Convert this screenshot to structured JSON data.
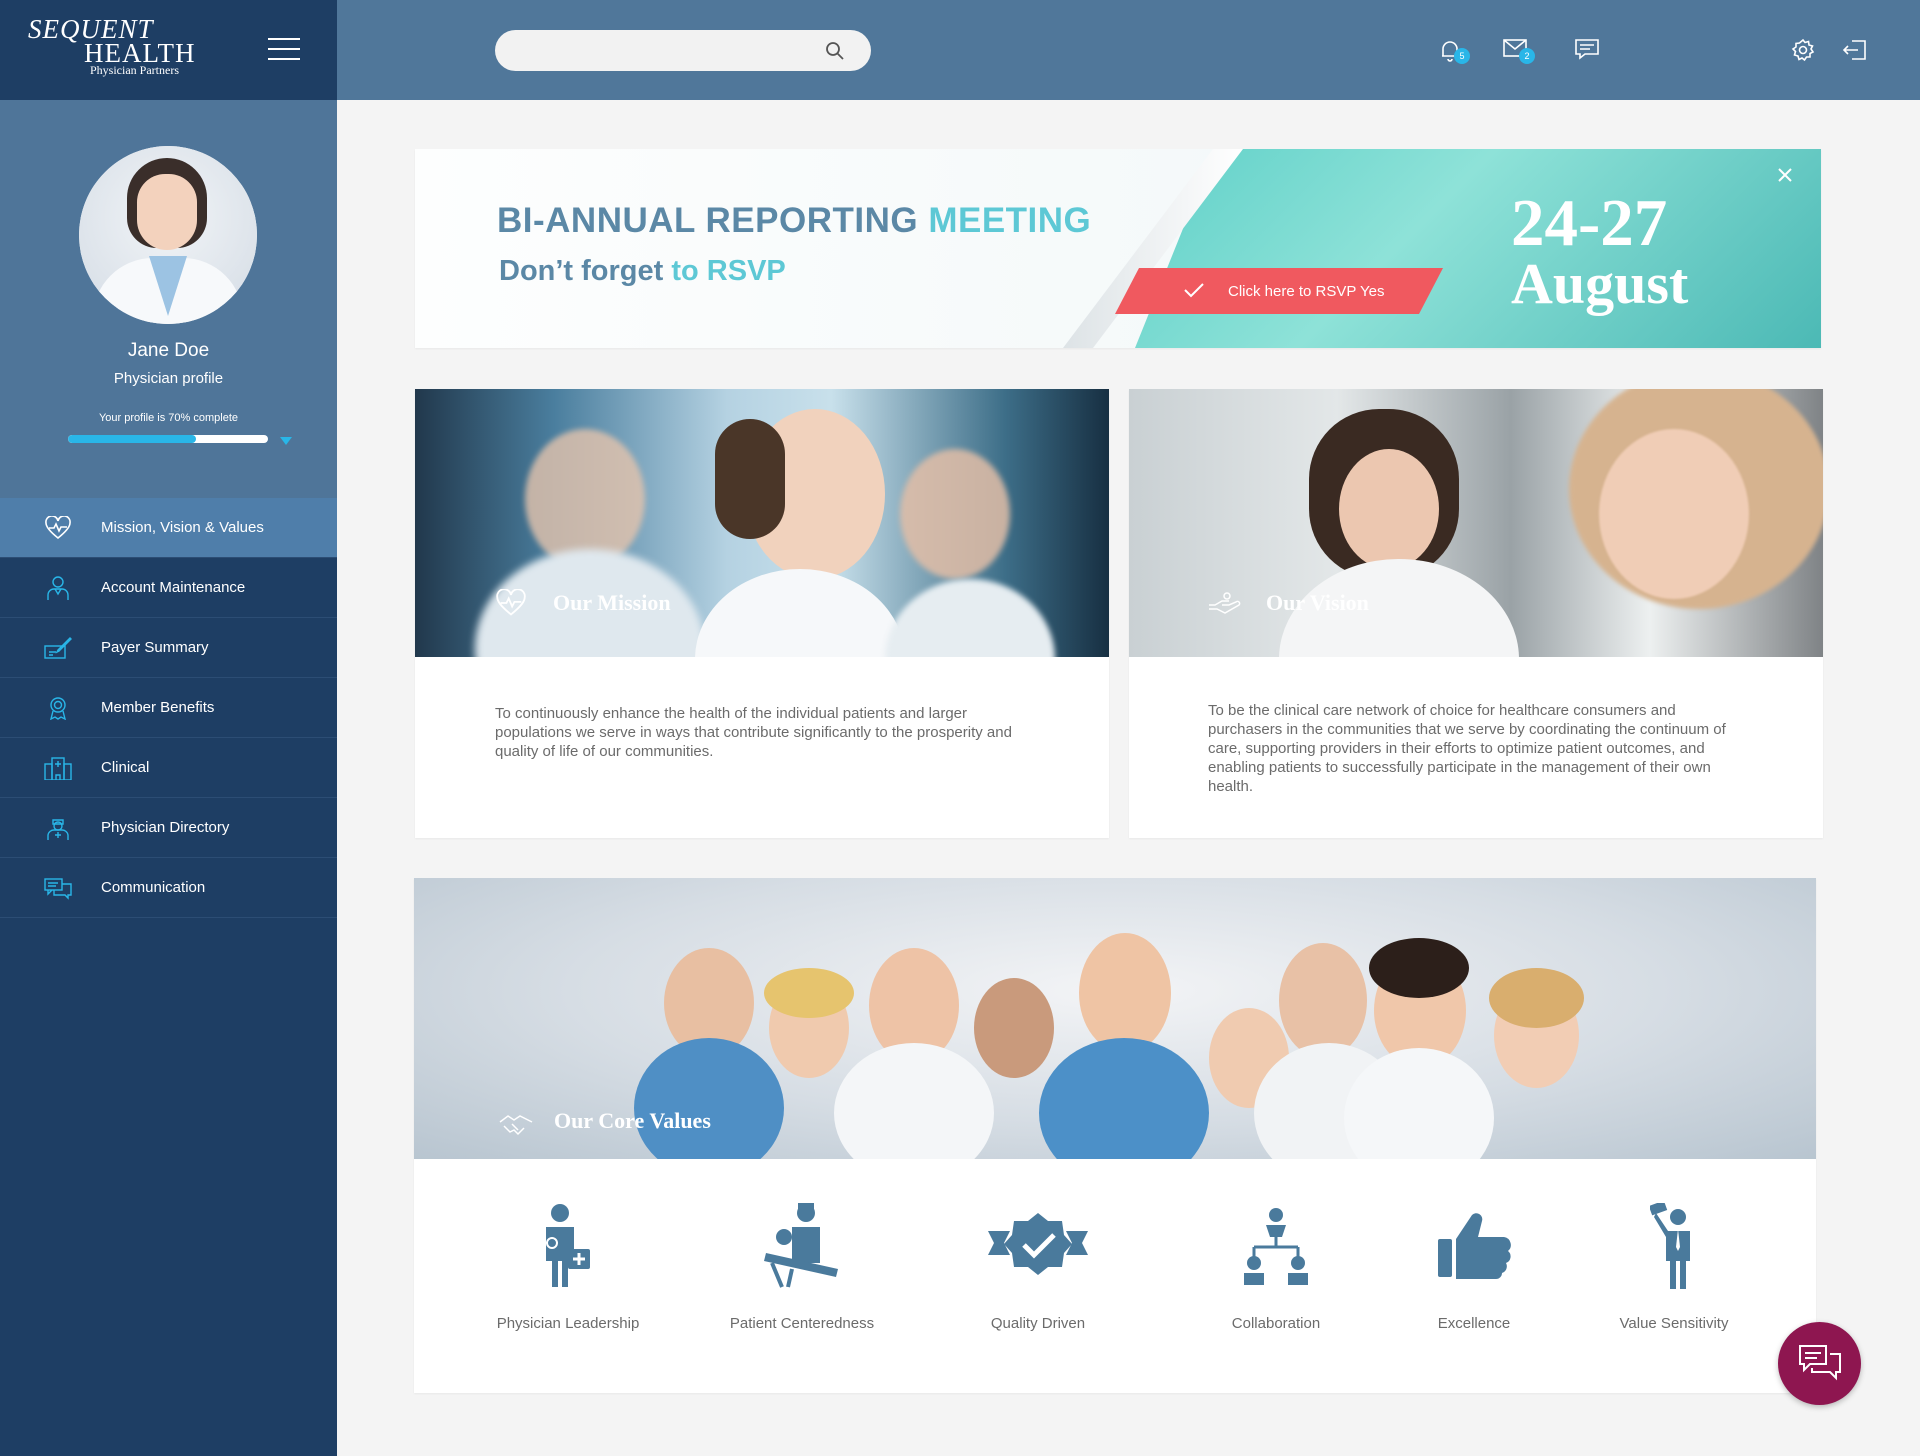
{
  "brand": {
    "line1": "SEQUENT",
    "line2": "HEALTH",
    "line3": "Physician Partners"
  },
  "header": {
    "search": {
      "placeholder": "",
      "icon": "search-icon"
    },
    "notifications": {
      "count": "5",
      "icon": "bell-icon"
    },
    "messages": {
      "count": "2",
      "icon": "mail-icon"
    },
    "chat": {
      "icon": "chat-icon"
    },
    "settings": {
      "icon": "gear-icon"
    },
    "logout": {
      "icon": "logout-icon"
    }
  },
  "profile": {
    "name": "Jane Doe",
    "role": "Physician profile",
    "completion_text": "Your profile is 70% complete",
    "completion_percent": 64
  },
  "sidebar": {
    "items": [
      {
        "label": "Mission, Vision & Values",
        "icon": "heart-pulse-icon",
        "active": true
      },
      {
        "label": "Account Maintenance",
        "icon": "user-account-icon"
      },
      {
        "label": "Payer Summary",
        "icon": "payer-icon"
      },
      {
        "label": "Member Benefits",
        "icon": "award-icon"
      },
      {
        "label": "Clinical",
        "icon": "hospital-icon"
      },
      {
        "label": "Physician Directory",
        "icon": "doctor-icon"
      },
      {
        "label": "Communication",
        "icon": "communication-icon"
      }
    ]
  },
  "banner": {
    "title_a": "BI-ANNUAL REPORTING ",
    "title_b": "MEETING",
    "sub_a": "Don’t forget ",
    "sub_b": "to RSVP",
    "rsvp_label": "Click here to RSVP Yes",
    "date_range": "24-27",
    "date_month": "August"
  },
  "mission": {
    "heading": "Our Mission",
    "text": "To continuously enhance the health of the individual patients and larger populations we serve in ways that contribute significantly to the prosperity and quality of life of our communities."
  },
  "vision": {
    "heading": "Our Vision",
    "text": "To be the clinical care network of choice for healthcare consumers and purchasers in the communities that we serve by coordinating the continuum of care, supporting providers in their efforts to optimize patient outcomes, and enabling patients to successfully participate in the management of their own health."
  },
  "values": {
    "heading": "Our Core Values",
    "items": [
      {
        "label": "Physician Leadership",
        "icon": "physician-icon"
      },
      {
        "label": "Patient Centeredness",
        "icon": "patient-care-icon"
      },
      {
        "label": "Quality Driven",
        "icon": "quality-badge-icon"
      },
      {
        "label": "Collaboration",
        "icon": "org-chart-icon"
      },
      {
        "label": "Excellence",
        "icon": "thumbs-up-icon"
      },
      {
        "label": "Value Sensitivity",
        "icon": "businessman-icon"
      }
    ]
  },
  "colors": {
    "accent": "#29b6e8",
    "sidebar": "#1e3e64",
    "topbar": "#50779a",
    "rsvp": "#f0595f",
    "fab": "#8e1650",
    "icon": "#4a7a9c"
  }
}
